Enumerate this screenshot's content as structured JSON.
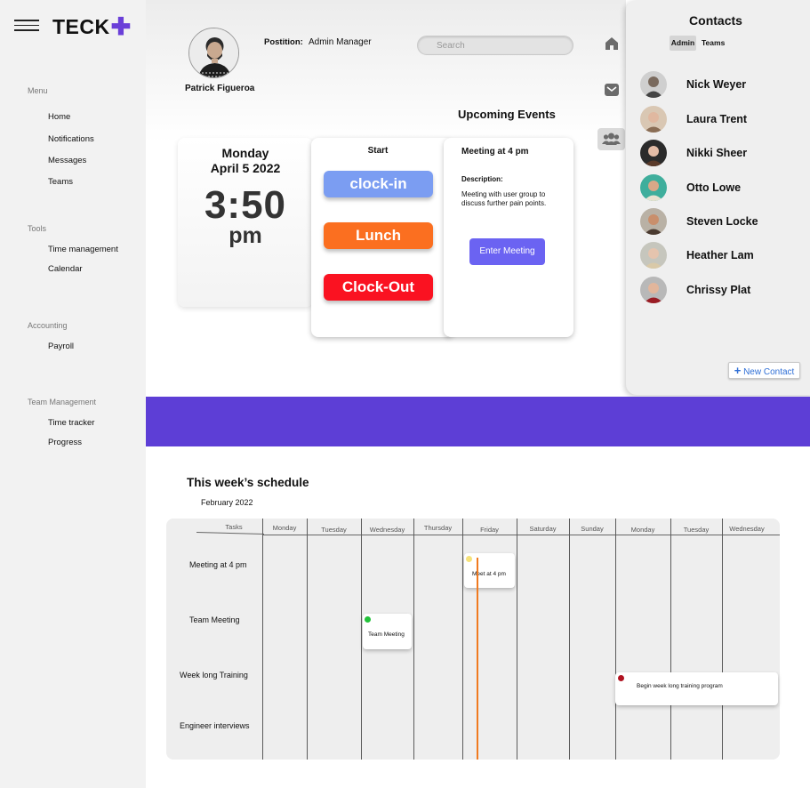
{
  "app": {
    "logo_text": "TECK",
    "logo_plus": "✚",
    "brand_color": "#6a3fd8"
  },
  "sidebar": {
    "sections": [
      {
        "title": "Menu",
        "items": [
          "Home",
          "Notifications",
          "Messages",
          "Teams"
        ]
      },
      {
        "title": "Tools",
        "items": [
          "Time management",
          "Calendar"
        ]
      },
      {
        "title": "Accounting",
        "items": [
          "Payroll"
        ]
      },
      {
        "title": "Team Management",
        "items": [
          "Time tracker",
          "Progress"
        ]
      }
    ]
  },
  "profile": {
    "name": "Patrick Figueroa",
    "position_label": "Postition:",
    "position_value": "Admin Manager"
  },
  "search": {
    "placeholder": "Search"
  },
  "upcoming": {
    "title": "Upcoming Events"
  },
  "date_card": {
    "day": "Monday",
    "date": "April 5 2022",
    "time": "3:50",
    "ampm": "pm"
  },
  "clock_card": {
    "title": "Start",
    "clock_in": "clock-in",
    "lunch": "Lunch",
    "clock_out": "Clock-Out"
  },
  "meeting_card": {
    "title": "Meeting at 4 pm",
    "desc_label": "Description:",
    "desc_text": "Meeting with user group to discuss further pain points.",
    "button": "Enter Meeting"
  },
  "side_icons": [
    "home-icon",
    "mail-icon",
    "group-icon"
  ],
  "contacts": {
    "title": "Contacts",
    "tabs": [
      "Admin",
      "Teams"
    ],
    "people": [
      "Nick Weyer",
      "Laura Trent",
      "Nikki Sheer",
      "Otto Lowe",
      "Steven Locke",
      "Heather Lam",
      "Chrissy Plat"
    ],
    "new_contact_plus": "+",
    "new_contact": "New Contact"
  },
  "schedule": {
    "title": "This week’s schedule",
    "month": "February 2022",
    "tasks_header": "Tasks",
    "days": [
      "Monday",
      "Tuesday",
      "Wednesday",
      "Thursday",
      "Friday",
      "Saturday",
      "Sunday",
      "Monday",
      "Tuesday",
      "Wednesday"
    ],
    "tasks": [
      "Meeting at 4 pm",
      "Team Meeting",
      "Week long Training",
      "Engineer interviews"
    ],
    "events": [
      {
        "text": "Meet at 4 pm",
        "dot_color": "#f6e27a"
      },
      {
        "text": "Team Meeting",
        "dot_color": "#22c23a"
      },
      {
        "text": "Begin week long training program",
        "dot_color": "#b01220"
      }
    ]
  }
}
